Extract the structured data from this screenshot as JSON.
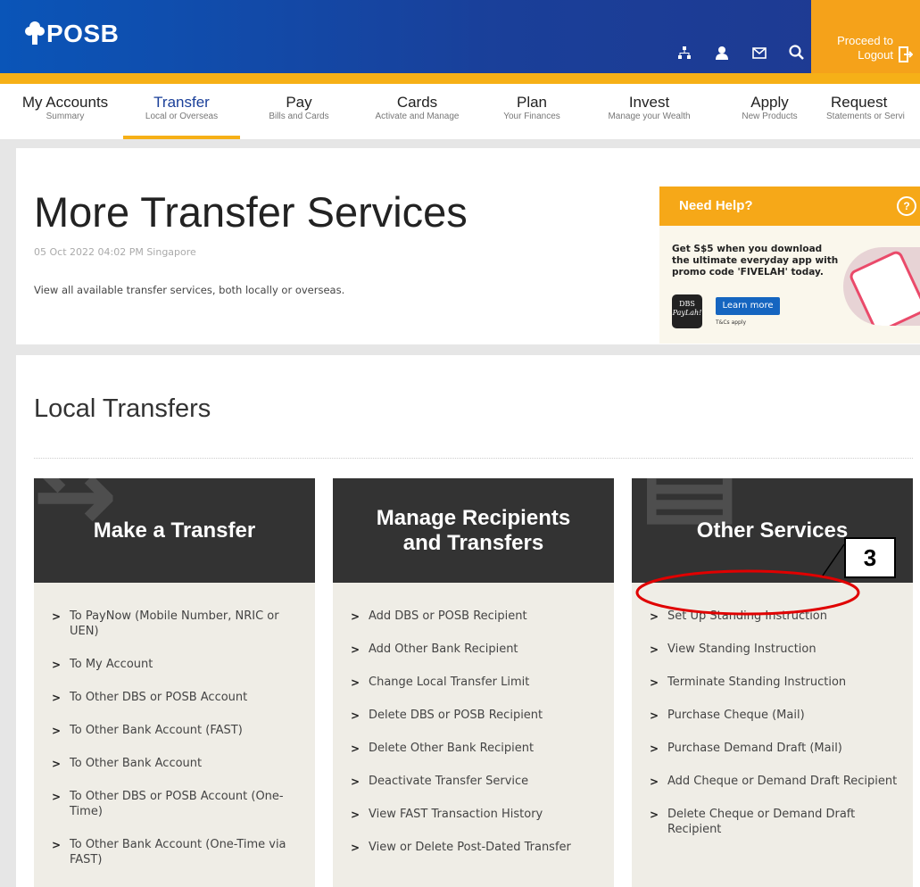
{
  "header": {
    "brand": "POSB",
    "logout_line1": "Proceed to",
    "logout_line2": "Logout",
    "icons": [
      "sitemap-icon",
      "user-icon",
      "mail-icon",
      "search-icon",
      "logout-icon"
    ]
  },
  "nav": [
    {
      "title": "My Accounts",
      "sub": "Summary"
    },
    {
      "title": "Transfer",
      "sub": "Local or Overseas"
    },
    {
      "title": "Pay",
      "sub": "Bills and Cards"
    },
    {
      "title": "Cards",
      "sub": "Activate and Manage"
    },
    {
      "title": "Plan",
      "sub": "Your Finances"
    },
    {
      "title": "Invest",
      "sub": "Manage your Wealth"
    },
    {
      "title": "Apply",
      "sub": "New Products"
    },
    {
      "title": "Request",
      "sub": "Statements or Servi"
    }
  ],
  "page": {
    "title": "More Transfer Services",
    "timestamp": "05 Oct 2022 04:02 PM Singapore",
    "description": "View all available transfer services, both locally or overseas."
  },
  "help": {
    "heading": "Need Help?",
    "promo": "Get S$5 when you download the ultimate everyday app with promo code 'FIVELAH' today.",
    "app_line1": "DBS",
    "app_line2": "PayLah!",
    "learn_more": "Learn more",
    "tcs": "T&Cs apply"
  },
  "local": {
    "title": "Local Transfers",
    "cards": [
      {
        "heading": "Make a Transfer",
        "items": [
          "To PayNow (Mobile Number, NRIC or UEN)",
          "To My Account",
          "To Other DBS or POSB Account",
          "To Other Bank Account (FAST)",
          "To Other Bank Account",
          "To Other DBS or POSB Account (One-Time)",
          "To Other Bank Account (One-Time via FAST)"
        ]
      },
      {
        "heading_line1": "Manage Recipients",
        "heading_line2": "and Transfers",
        "items": [
          "Add DBS or POSB Recipient",
          "Add Other Bank Recipient",
          "Change Local Transfer Limit",
          "Delete DBS or POSB Recipient",
          "Delete Other Bank Recipient",
          "Deactivate Transfer Service",
          "View FAST Transaction History",
          "View or Delete Post-Dated Transfer"
        ]
      },
      {
        "heading": "Other Services",
        "items": [
          "Set Up Standing Instruction",
          "View Standing Instruction",
          "Terminate Standing Instruction",
          "Purchase Cheque (Mail)",
          "Purchase Demand Draft (Mail)",
          "Add Cheque or Demand Draft Recipient",
          "Delete Cheque or Demand Draft Recipient"
        ]
      }
    ]
  },
  "annotation": {
    "step": "3",
    "color": "#e00000"
  },
  "colors": {
    "brand_blue": "#1a3f99",
    "accent": "#f6b017",
    "logout": "#f5a21a",
    "card_head": "#333333"
  }
}
